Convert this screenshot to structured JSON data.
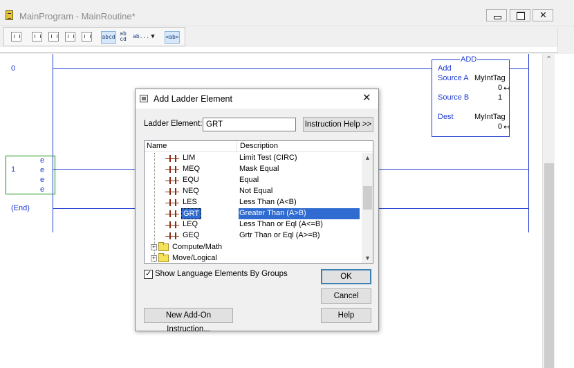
{
  "window": {
    "title": "MainProgram - MainRoutine*"
  },
  "toolbar": {
    "buttons": [
      {
        "icon": "rung-insert-icon",
        "label": ""
      },
      {
        "icon": "branch-icon",
        "label": ""
      },
      {
        "icon": "branch-level-icon",
        "label": ""
      },
      {
        "icon": "xic-icon",
        "label": ""
      },
      {
        "icon": "ote-icon",
        "label": ""
      },
      {
        "icon": "tag-description-icon",
        "label": "abcd",
        "selected": true
      },
      {
        "icon": "operand-icon",
        "label": "ab cd"
      },
      {
        "icon": "text-dropdown-icon",
        "label": "ab..."
      },
      {
        "icon": "dropdown-arrow-icon",
        "label": "▼"
      },
      {
        "icon": "ab-toggle-icon",
        "label": "<ab>",
        "selected": true
      }
    ]
  },
  "ladder": {
    "rung0_number": "0",
    "rung1_number": "1",
    "end_label": "(End)",
    "error_markers": [
      "e",
      "e",
      "e",
      "e"
    ],
    "add_instruction": {
      "title": "ADD",
      "name": "Add",
      "source_a_label": "Source A",
      "source_a_tag": "MyIntTag",
      "source_a_value": "0",
      "source_b_label": "Source B",
      "source_b_value": "1",
      "dest_label": "Dest",
      "dest_tag": "MyIntTag",
      "dest_value": "0"
    }
  },
  "dialog": {
    "title": "Add Ladder Element",
    "close_glyph": "✕",
    "ladder_element_label": "Ladder Element:",
    "ladder_element_value": "GRT",
    "instruction_help_button": "Instruction Help >>",
    "columns": {
      "name": "Name",
      "description": "Description"
    },
    "rows": [
      {
        "name": "LIM",
        "description": "Limit Test (CIRC)",
        "selected": false
      },
      {
        "name": "MEQ",
        "description": "Mask Equal",
        "selected": false
      },
      {
        "name": "EQU",
        "description": "Equal",
        "selected": false
      },
      {
        "name": "NEQ",
        "description": "Not Equal",
        "selected": false
      },
      {
        "name": "LES",
        "description": "Less Than (A<B)",
        "selected": false
      },
      {
        "name": "GRT",
        "description": "Greater Than (A>B)",
        "selected": true
      },
      {
        "name": "LEQ",
        "description": "Less Than or Eql (A<=B)",
        "selected": false
      },
      {
        "name": "GEQ",
        "description": "Grtr Than or Eql (A>=B)",
        "selected": false
      }
    ],
    "groups": [
      {
        "label": "Compute/Math",
        "expander": "+"
      },
      {
        "label": "Move/Logical",
        "expander": "+"
      }
    ],
    "show_groups_label": "Show Language Elements By Groups",
    "show_groups_checked": "✓",
    "ok_button": "OK",
    "cancel_button": "Cancel",
    "help_button": "Help",
    "new_aoi_button": "New Add-On Instruction..."
  }
}
